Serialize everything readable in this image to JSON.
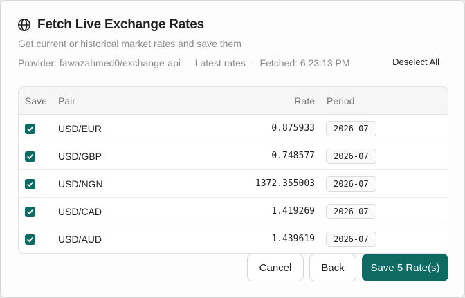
{
  "dialog": {
    "title": "Fetch Live Exchange Rates",
    "subtitle": "Get current or historical market rates and save them",
    "meta": {
      "provider": "Provider: fawazahmed0/exchange-api",
      "mode": "Latest rates",
      "fetched": "Fetched: 6:23:13 PM",
      "separator": "·"
    },
    "deselect_label": "Deselect All"
  },
  "table": {
    "headers": {
      "save": "Save",
      "pair": "Pair",
      "rate": "Rate",
      "period": "Period"
    },
    "rows": [
      {
        "checked": true,
        "pair": "USD/EUR",
        "rate": "0.875933",
        "period": "2026-07"
      },
      {
        "checked": true,
        "pair": "USD/GBP",
        "rate": "0.748577",
        "period": "2026-07"
      },
      {
        "checked": true,
        "pair": "USD/NGN",
        "rate": "1372.355003",
        "period": "2026-07"
      },
      {
        "checked": true,
        "pair": "USD/CAD",
        "rate": "1.419269",
        "period": "2026-07"
      },
      {
        "checked": true,
        "pair": "USD/AUD",
        "rate": "1.439619",
        "period": "2026-07"
      }
    ]
  },
  "footer": {
    "cancel_label": "Cancel",
    "back_label": "Back",
    "save_label": "Save 5 Rate(s)"
  },
  "icons": {
    "title_icon": "globe-icon",
    "checkbox_icon": "checkmark-icon"
  },
  "colors": {
    "accent": "#0d6b63",
    "muted_text": "#8a8a8a"
  }
}
